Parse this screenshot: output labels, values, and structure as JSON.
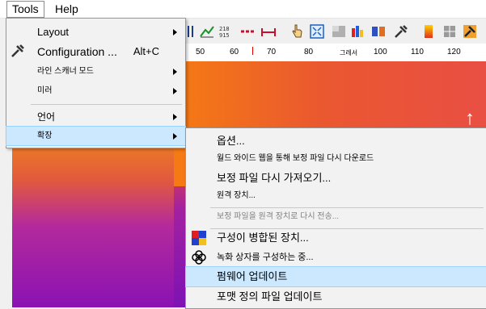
{
  "menubar": {
    "tools": "Tools",
    "help": "Help"
  },
  "ruler": {
    "ticks": [
      "50",
      "60",
      "70",
      "80",
      "그레서",
      "100",
      "110",
      "120"
    ]
  },
  "tools_menu": {
    "items": [
      {
        "label": "Layout",
        "has_submenu": true
      },
      {
        "label": "Configuration ...",
        "shortcut": "Alt+C",
        "has_submenu": false
      },
      {
        "label": "라인 스캐너 모드",
        "has_submenu": true
      },
      {
        "label": "미러",
        "has_submenu": true
      },
      {
        "label": "언어",
        "has_submenu": true
      },
      {
        "label": "확장",
        "has_submenu": true,
        "highlighted": true
      }
    ]
  },
  "ext_menu": {
    "items": [
      {
        "label": "옵션..."
      },
      {
        "label": "월드 와이드 웹을 통해 보정 파일 다시 다운로드"
      },
      {
        "label": "보정 파일 다시 가져오기..."
      },
      {
        "label": "원격 장치..."
      },
      {
        "label": "보정 파일을 원격 장치로 다시 전송...",
        "disabled": true
      },
      {
        "label": "구성이 병합된 장치..."
      },
      {
        "label": "녹화 상자를 구성하는 중..."
      },
      {
        "label": "펌웨어 업데이트",
        "highlighted": true
      },
      {
        "label": "포맷 정의 파일 업데이트"
      }
    ]
  }
}
